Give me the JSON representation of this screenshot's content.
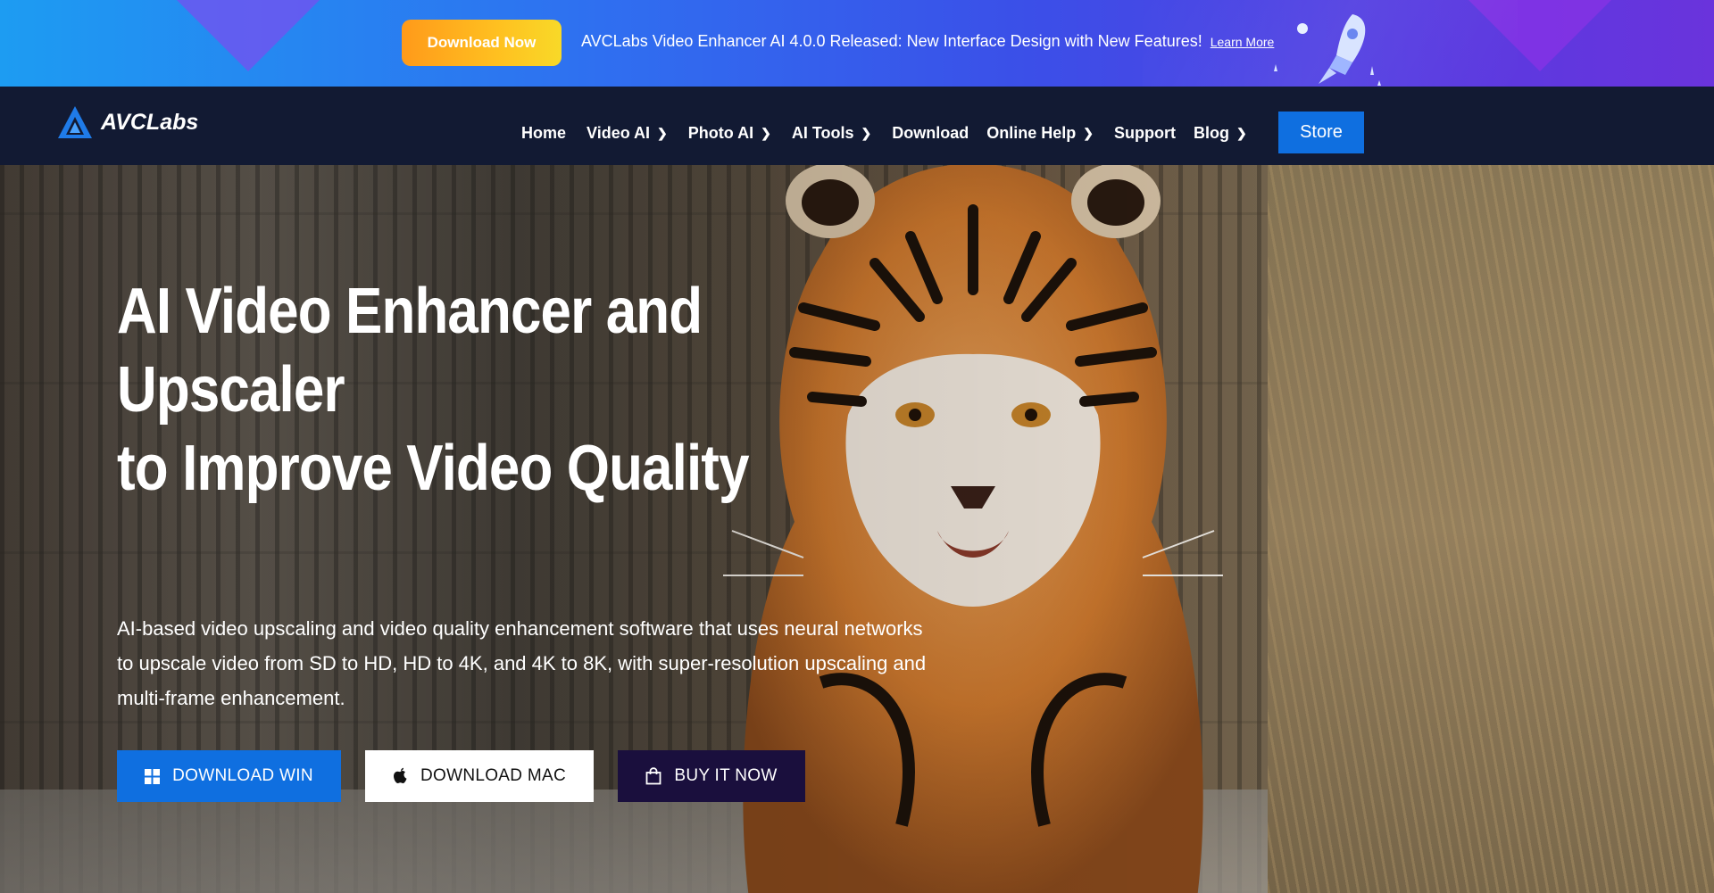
{
  "promo": {
    "button_label": "Download Now",
    "message": "AVCLabs Video Enhancer AI 4.0.0 Released: New Interface Design with New Features!",
    "link_label": "Learn More"
  },
  "nav": {
    "logo_text": "AVCLabs",
    "items": [
      {
        "label": "Home",
        "has_dropdown": false
      },
      {
        "label": "Video AI",
        "has_dropdown": true
      },
      {
        "label": "Photo AI",
        "has_dropdown": true
      },
      {
        "label": "AI Tools",
        "has_dropdown": true
      },
      {
        "label": "Download",
        "has_dropdown": false
      },
      {
        "label": "Online Help",
        "has_dropdown": true
      },
      {
        "label": "Support",
        "has_dropdown": false
      },
      {
        "label": "Blog",
        "has_dropdown": true
      }
    ],
    "store_label": "Store"
  },
  "hero": {
    "title_line1": "AI Video Enhancer and Upscaler",
    "title_line2": "to Improve Video Quality",
    "description": "AI-based video upscaling and video quality enhancement software that uses neural networks to upscale video from SD to HD, HD to 4K, and 4K to 8K, with super-resolution upscaling and multi-frame enhancement.",
    "buttons": {
      "win_label": "DOWNLOAD WIN",
      "mac_label": "DOWNLOAD MAC",
      "buy_label": "BUY IT NOW"
    }
  },
  "colors": {
    "accent_blue": "#0f6fe0",
    "nav_bg": "#121a33",
    "buy_bg": "#1a0f3d",
    "promo_btn": "#ffb020"
  },
  "icons": {
    "logo": "avclabs-logo-icon",
    "win": "windows-icon",
    "mac": "apple-icon",
    "buy": "shopping-bag-icon",
    "rocket": "rocket-icon",
    "chevron": "chevron-right-icon"
  }
}
